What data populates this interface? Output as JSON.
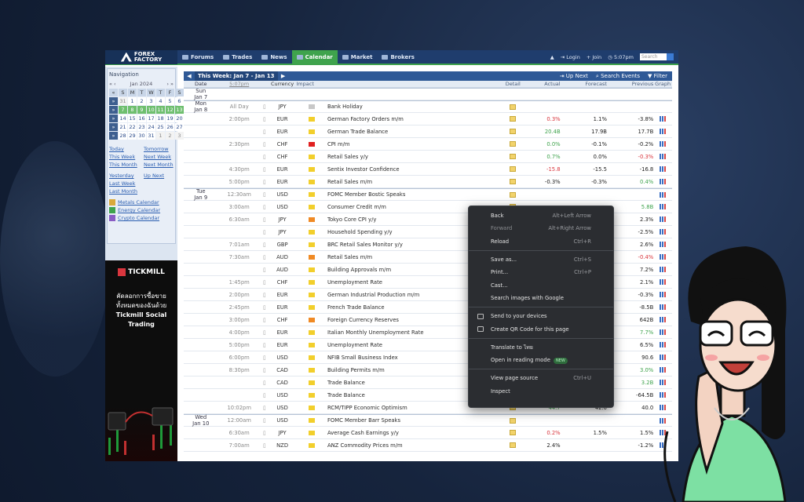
{
  "nav": {
    "logo": [
      "FOREX",
      "FACTORY"
    ],
    "items": [
      "Forums",
      "Trades",
      "News",
      "Calendar",
      "Market",
      "Brokers"
    ],
    "login": "Login",
    "join": "Join",
    "time": "5:07pm",
    "search_placeholder": "Search"
  },
  "sidebar": {
    "title": "Navigation",
    "month": "Jan 2024",
    "prev": "«  ‹",
    "next": "›  »",
    "weekdays": [
      "S",
      "M",
      "T",
      "W",
      "T",
      "F",
      "S"
    ],
    "weeks": [
      [
        "31",
        "1",
        "2",
        "3",
        "4",
        "5",
        "6"
      ],
      [
        "7",
        "8",
        "9",
        "10",
        "11",
        "12",
        "13"
      ],
      [
        "14",
        "15",
        "16",
        "17",
        "18",
        "19",
        "20"
      ],
      [
        "21",
        "22",
        "23",
        "24",
        "25",
        "26",
        "27"
      ],
      [
        "28",
        "29",
        "30",
        "31",
        "1",
        "2",
        "3"
      ]
    ],
    "links": [
      "Today",
      "Tomorrow",
      "This Week",
      "Next Week",
      "This Month",
      "Next Month"
    ],
    "links2": [
      "Yesterday",
      "Up Next",
      "Last Week",
      "",
      "Last Month",
      ""
    ],
    "calendars": [
      "Metals Calendar",
      "Energy Calendar",
      "Crypto Calendar"
    ]
  },
  "ad": {
    "brand": "TICKMILL",
    "line1": "คัดลอกการซื้อขาย",
    "line2": "ทั้งหมดของฉันด้วย",
    "line3": "Tickmill Social",
    "line4": "Trading"
  },
  "calendar": {
    "week_label": "This Week: Jan 7 - Jan 13",
    "up_next": "Up Next",
    "search_events": "Search Events",
    "filter": "Filter",
    "headers": {
      "date": "Date",
      "time": "5:07pm",
      "currency": "Currency",
      "impact": "Impact",
      "detail": "Detail",
      "actual": "Actual",
      "forecast": "Forecast",
      "previous": "Previous",
      "graph": "Graph"
    },
    "rows": [
      {
        "d1": "Sun",
        "d2": "Jan 7",
        "time": "",
        "cur": "",
        "imp": "",
        "evt": "",
        "act": "",
        "for": "",
        "prev": "",
        "ac": "",
        "pc": "",
        "day": true
      },
      {
        "d1": "Mon",
        "d2": "Jan 8",
        "time": "All Day",
        "cur": "JPY",
        "imp": "gray",
        "evt": "Bank Holiday",
        "act": "",
        "for": "",
        "prev": "",
        "ac": "",
        "pc": "",
        "day": true
      },
      {
        "d1": "",
        "d2": "",
        "time": "2:00pm",
        "cur": "EUR",
        "imp": "yellow",
        "evt": "German Factory Orders m/m",
        "act": "0.3%",
        "for": "1.1%",
        "prev": "-3.8%",
        "ac": "red",
        "pc": ""
      },
      {
        "d1": "",
        "d2": "",
        "time": "",
        "cur": "EUR",
        "imp": "yellow",
        "evt": "German Trade Balance",
        "act": "20.4B",
        "for": "17.9B",
        "prev": "17.7B",
        "ac": "green",
        "pc": ""
      },
      {
        "d1": "",
        "d2": "",
        "time": "2:30pm",
        "cur": "CHF",
        "imp": "red",
        "evt": "CPI m/m",
        "act": "0.0%",
        "for": "-0.1%",
        "prev": "-0.2%",
        "ac": "green",
        "pc": ""
      },
      {
        "d1": "",
        "d2": "",
        "time": "",
        "cur": "CHF",
        "imp": "yellow",
        "evt": "Retail Sales y/y",
        "act": "0.7%",
        "for": "0.0%",
        "prev": "-0.3%",
        "ac": "green",
        "pc": "red"
      },
      {
        "d1": "",
        "d2": "",
        "time": "4:30pm",
        "cur": "EUR",
        "imp": "yellow",
        "evt": "Sentix Investor Confidence",
        "act": "-15.8",
        "for": "-15.5",
        "prev": "-16.8",
        "ac": "red",
        "pc": ""
      },
      {
        "d1": "",
        "d2": "",
        "time": "5:00pm",
        "cur": "EUR",
        "imp": "yellow",
        "evt": "Retail Sales m/m",
        "act": "-0.3%",
        "for": "-0.3%",
        "prev": "0.4%",
        "ac": "",
        "pc": "green"
      },
      {
        "d1": "Tue",
        "d2": "Jan 9",
        "time": "12:30am",
        "cur": "USD",
        "imp": "yellow",
        "evt": "FOMC Member Bostic Speaks",
        "act": "",
        "for": "",
        "prev": "",
        "ac": "",
        "pc": "",
        "day": true
      },
      {
        "d1": "",
        "d2": "",
        "time": "3:00am",
        "cur": "USD",
        "imp": "yellow",
        "evt": "Consumer Credit m/m",
        "act": "",
        "for": "",
        "prev": "5.8B",
        "ac": "",
        "pc": "green"
      },
      {
        "d1": "",
        "d2": "",
        "time": "6:30am",
        "cur": "JPY",
        "imp": "orange",
        "evt": "Tokyo Core CPI y/y",
        "act": "",
        "for": "",
        "prev": "2.3%",
        "ac": "",
        "pc": ""
      },
      {
        "d1": "",
        "d2": "",
        "time": "",
        "cur": "JPY",
        "imp": "yellow",
        "evt": "Household Spending y/y",
        "act": "",
        "for": "",
        "prev": "-2.5%",
        "ac": "",
        "pc": ""
      },
      {
        "d1": "",
        "d2": "",
        "time": "7:01am",
        "cur": "GBP",
        "imp": "yellow",
        "evt": "BRC Retail Sales Monitor y/y",
        "act": "",
        "for": "",
        "prev": "2.6%",
        "ac": "",
        "pc": ""
      },
      {
        "d1": "",
        "d2": "",
        "time": "7:30am",
        "cur": "AUD",
        "imp": "orange",
        "evt": "Retail Sales m/m",
        "act": "",
        "for": "",
        "prev": "-0.4%",
        "ac": "",
        "pc": "red"
      },
      {
        "d1": "",
        "d2": "",
        "time": "",
        "cur": "AUD",
        "imp": "yellow",
        "evt": "Building Approvals m/m",
        "act": "",
        "for": "",
        "prev": "7.2%",
        "ac": "",
        "pc": ""
      },
      {
        "d1": "",
        "d2": "",
        "time": "1:45pm",
        "cur": "CHF",
        "imp": "yellow",
        "evt": "Unemployment Rate",
        "act": "",
        "for": "",
        "prev": "2.1%",
        "ac": "",
        "pc": ""
      },
      {
        "d1": "",
        "d2": "",
        "time": "2:00pm",
        "cur": "EUR",
        "imp": "yellow",
        "evt": "German Industrial Production m/m",
        "act": "",
        "for": "",
        "prev": "-0.3%",
        "ac": "",
        "pc": ""
      },
      {
        "d1": "",
        "d2": "",
        "time": "2:45pm",
        "cur": "EUR",
        "imp": "yellow",
        "evt": "French Trade Balance",
        "act": "",
        "for": "",
        "prev": "-8.5B",
        "ac": "",
        "pc": ""
      },
      {
        "d1": "",
        "d2": "",
        "time": "3:00pm",
        "cur": "CHF",
        "imp": "orange",
        "evt": "Foreign Currency Reserves",
        "act": "",
        "for": "",
        "prev": "642B",
        "ac": "",
        "pc": ""
      },
      {
        "d1": "",
        "d2": "",
        "time": "4:00pm",
        "cur": "EUR",
        "imp": "yellow",
        "evt": "Italian Monthly Unemployment Rate",
        "act": "",
        "for": "",
        "prev": "7.7%",
        "ac": "",
        "pc": "green"
      },
      {
        "d1": "",
        "d2": "",
        "time": "5:00pm",
        "cur": "EUR",
        "imp": "yellow",
        "evt": "Unemployment Rate",
        "act": "",
        "for": "",
        "prev": "6.5%",
        "ac": "",
        "pc": ""
      },
      {
        "d1": "",
        "d2": "",
        "time": "6:00pm",
        "cur": "USD",
        "imp": "yellow",
        "evt": "NFIB Small Business Index",
        "act": "",
        "for": "",
        "prev": "90.6",
        "ac": "",
        "pc": ""
      },
      {
        "d1": "",
        "d2": "",
        "time": "8:30pm",
        "cur": "CAD",
        "imp": "yellow",
        "evt": "Building Permits m/m",
        "act": "",
        "for": "",
        "prev": "3.0%",
        "ac": "",
        "pc": "green"
      },
      {
        "d1": "",
        "d2": "",
        "time": "",
        "cur": "CAD",
        "imp": "yellow",
        "evt": "Trade Balance",
        "act": "",
        "for": "",
        "prev": "3.2B",
        "ac": "",
        "pc": "green"
      },
      {
        "d1": "",
        "d2": "",
        "time": "",
        "cur": "USD",
        "imp": "yellow",
        "evt": "Trade Balance",
        "act": "-63.2B",
        "for": "-64.9B",
        "prev": "-64.5B",
        "ac": "green",
        "pc": ""
      },
      {
        "d1": "",
        "d2": "",
        "time": "10:02pm",
        "cur": "USD",
        "imp": "yellow",
        "evt": "RCM/TIPP Economic Optimism",
        "act": "44.7",
        "for": "42.0",
        "prev": "40.0",
        "ac": "green",
        "pc": ""
      },
      {
        "d1": "Wed",
        "d2": "Jan 10",
        "time": "12:00am",
        "cur": "USD",
        "imp": "yellow",
        "evt": "FOMC Member Barr Speaks",
        "act": "",
        "for": "",
        "prev": "",
        "ac": "",
        "pc": "",
        "day": true
      },
      {
        "d1": "",
        "d2": "",
        "time": "6:30am",
        "cur": "JPY",
        "imp": "yellow",
        "evt": "Average Cash Earnings y/y",
        "act": "0.2%",
        "for": "1.5%",
        "prev": "1.5%",
        "ac": "red",
        "pc": ""
      },
      {
        "d1": "",
        "d2": "",
        "time": "7:00am",
        "cur": "NZD",
        "imp": "yellow",
        "evt": "ANZ Commodity Prices m/m",
        "act": "2.4%",
        "for": "",
        "prev": "-1.2%",
        "ac": "",
        "pc": ""
      }
    ]
  },
  "context_menu": {
    "items": [
      {
        "label": "Back",
        "shortcut": "Alt+Left Arrow",
        "dim": false
      },
      {
        "label": "Forward",
        "shortcut": "Alt+Right Arrow",
        "dim": true
      },
      {
        "label": "Reload",
        "shortcut": "Ctrl+R",
        "dim": false
      },
      {
        "sep": true
      },
      {
        "label": "Save as...",
        "shortcut": "Ctrl+S",
        "dim": false
      },
      {
        "label": "Print...",
        "shortcut": "Ctrl+P",
        "dim": false
      },
      {
        "label": "Cast...",
        "shortcut": "",
        "dim": false
      },
      {
        "label": "Search images with Google",
        "shortcut": "",
        "dim": false
      },
      {
        "sep": true
      },
      {
        "label": "Send to your devices",
        "shortcut": "",
        "dim": false,
        "icon": true
      },
      {
        "label": "Create QR Code for this page",
        "shortcut": "",
        "dim": false,
        "icon": true
      },
      {
        "sep": true
      },
      {
        "label": "Translate to ไทย",
        "shortcut": "",
        "dim": false
      },
      {
        "label": "Open in reading mode",
        "shortcut": "",
        "dim": false,
        "badge": "NEW"
      },
      {
        "sep": true
      },
      {
        "label": "View page source",
        "shortcut": "Ctrl+U",
        "dim": false
      },
      {
        "label": "Inspect",
        "shortcut": "",
        "dim": false
      }
    ]
  },
  "colors": {
    "impact_yellow": "#f2cf2c",
    "impact_orange": "#f08a24",
    "impact_red": "#e02020",
    "impact_gray": "#c8c8c8"
  }
}
